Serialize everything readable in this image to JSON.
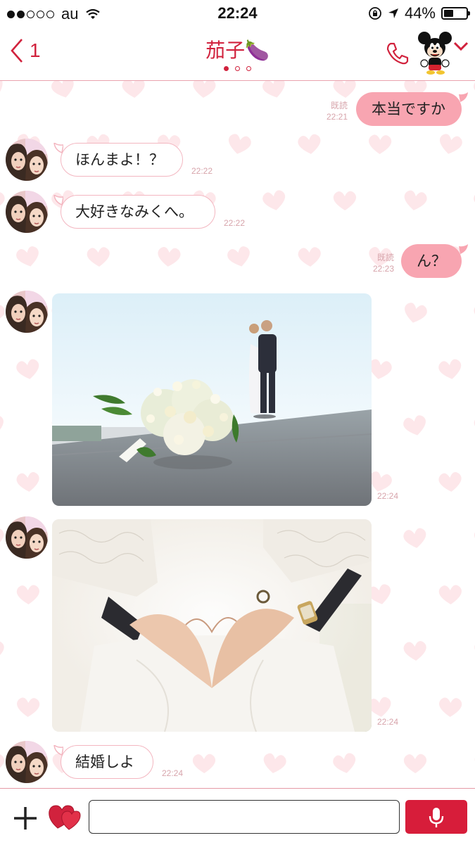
{
  "status_bar": {
    "carrier": "au",
    "time": "22:24",
    "battery": "44%",
    "battery_level": 0.44
  },
  "header": {
    "back_count": "1",
    "title": "茄子🍆",
    "page_indicator": {
      "count": 3,
      "active": 1
    }
  },
  "colors": {
    "accent": "#d1223d",
    "outgoing_bubble": "#f8a5b1",
    "incoming_border": "#f3b6c0",
    "heart_pattern": "#fde7ea",
    "mic_button": "#d71d3a"
  },
  "icons": {
    "back": "chevron-left-icon",
    "call": "phone-icon",
    "profile": "mouse-mascot-icon",
    "menu": "chevron-down-icon",
    "add": "plus-icon",
    "sticker": "hearts-icon",
    "voice": "microphone-icon"
  },
  "messages": [
    {
      "direction": "out",
      "type": "text",
      "text": "本当ですか",
      "read": "既読",
      "time": "22:21"
    },
    {
      "direction": "in",
      "type": "text",
      "text": "ほんまよ！？",
      "time": "22:22"
    },
    {
      "direction": "in",
      "type": "text",
      "text": "大好きなみくへ。",
      "time": "22:22"
    },
    {
      "direction": "out",
      "type": "text",
      "text": "ん？",
      "read": "既読",
      "time": "22:23"
    },
    {
      "direction": "in",
      "type": "image",
      "image": "bouquet-with-couple-photo",
      "time": "22:24"
    },
    {
      "direction": "in",
      "type": "image",
      "image": "heart-hands-wedding-photo",
      "time": "22:24"
    },
    {
      "direction": "in",
      "type": "text",
      "text": "結婚しよ",
      "time": "22:24"
    }
  ],
  "composer": {
    "value": "",
    "placeholder": ""
  }
}
